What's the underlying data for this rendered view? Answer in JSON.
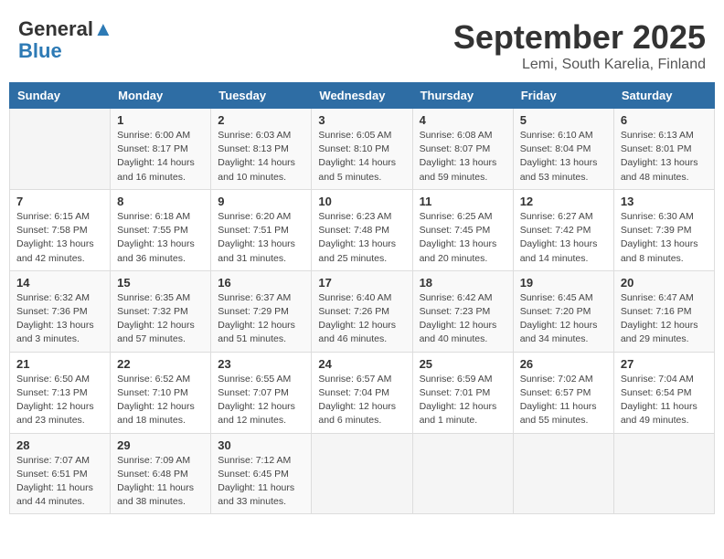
{
  "header": {
    "logo_general": "General",
    "logo_blue": "Blue",
    "month_title": "September 2025",
    "location": "Lemi, South Karelia, Finland"
  },
  "days_of_week": [
    "Sunday",
    "Monday",
    "Tuesday",
    "Wednesday",
    "Thursday",
    "Friday",
    "Saturday"
  ],
  "weeks": [
    [
      {
        "day": "",
        "info": ""
      },
      {
        "day": "1",
        "info": "Sunrise: 6:00 AM\nSunset: 8:17 PM\nDaylight: 14 hours\nand 16 minutes."
      },
      {
        "day": "2",
        "info": "Sunrise: 6:03 AM\nSunset: 8:13 PM\nDaylight: 14 hours\nand 10 minutes."
      },
      {
        "day": "3",
        "info": "Sunrise: 6:05 AM\nSunset: 8:10 PM\nDaylight: 14 hours\nand 5 minutes."
      },
      {
        "day": "4",
        "info": "Sunrise: 6:08 AM\nSunset: 8:07 PM\nDaylight: 13 hours\nand 59 minutes."
      },
      {
        "day": "5",
        "info": "Sunrise: 6:10 AM\nSunset: 8:04 PM\nDaylight: 13 hours\nand 53 minutes."
      },
      {
        "day": "6",
        "info": "Sunrise: 6:13 AM\nSunset: 8:01 PM\nDaylight: 13 hours\nand 48 minutes."
      }
    ],
    [
      {
        "day": "7",
        "info": "Sunrise: 6:15 AM\nSunset: 7:58 PM\nDaylight: 13 hours\nand 42 minutes."
      },
      {
        "day": "8",
        "info": "Sunrise: 6:18 AM\nSunset: 7:55 PM\nDaylight: 13 hours\nand 36 minutes."
      },
      {
        "day": "9",
        "info": "Sunrise: 6:20 AM\nSunset: 7:51 PM\nDaylight: 13 hours\nand 31 minutes."
      },
      {
        "day": "10",
        "info": "Sunrise: 6:23 AM\nSunset: 7:48 PM\nDaylight: 13 hours\nand 25 minutes."
      },
      {
        "day": "11",
        "info": "Sunrise: 6:25 AM\nSunset: 7:45 PM\nDaylight: 13 hours\nand 20 minutes."
      },
      {
        "day": "12",
        "info": "Sunrise: 6:27 AM\nSunset: 7:42 PM\nDaylight: 13 hours\nand 14 minutes."
      },
      {
        "day": "13",
        "info": "Sunrise: 6:30 AM\nSunset: 7:39 PM\nDaylight: 13 hours\nand 8 minutes."
      }
    ],
    [
      {
        "day": "14",
        "info": "Sunrise: 6:32 AM\nSunset: 7:36 PM\nDaylight: 13 hours\nand 3 minutes."
      },
      {
        "day": "15",
        "info": "Sunrise: 6:35 AM\nSunset: 7:32 PM\nDaylight: 12 hours\nand 57 minutes."
      },
      {
        "day": "16",
        "info": "Sunrise: 6:37 AM\nSunset: 7:29 PM\nDaylight: 12 hours\nand 51 minutes."
      },
      {
        "day": "17",
        "info": "Sunrise: 6:40 AM\nSunset: 7:26 PM\nDaylight: 12 hours\nand 46 minutes."
      },
      {
        "day": "18",
        "info": "Sunrise: 6:42 AM\nSunset: 7:23 PM\nDaylight: 12 hours\nand 40 minutes."
      },
      {
        "day": "19",
        "info": "Sunrise: 6:45 AM\nSunset: 7:20 PM\nDaylight: 12 hours\nand 34 minutes."
      },
      {
        "day": "20",
        "info": "Sunrise: 6:47 AM\nSunset: 7:16 PM\nDaylight: 12 hours\nand 29 minutes."
      }
    ],
    [
      {
        "day": "21",
        "info": "Sunrise: 6:50 AM\nSunset: 7:13 PM\nDaylight: 12 hours\nand 23 minutes."
      },
      {
        "day": "22",
        "info": "Sunrise: 6:52 AM\nSunset: 7:10 PM\nDaylight: 12 hours\nand 18 minutes."
      },
      {
        "day": "23",
        "info": "Sunrise: 6:55 AM\nSunset: 7:07 PM\nDaylight: 12 hours\nand 12 minutes."
      },
      {
        "day": "24",
        "info": "Sunrise: 6:57 AM\nSunset: 7:04 PM\nDaylight: 12 hours\nand 6 minutes."
      },
      {
        "day": "25",
        "info": "Sunrise: 6:59 AM\nSunset: 7:01 PM\nDaylight: 12 hours\nand 1 minute."
      },
      {
        "day": "26",
        "info": "Sunrise: 7:02 AM\nSunset: 6:57 PM\nDaylight: 11 hours\nand 55 minutes."
      },
      {
        "day": "27",
        "info": "Sunrise: 7:04 AM\nSunset: 6:54 PM\nDaylight: 11 hours\nand 49 minutes."
      }
    ],
    [
      {
        "day": "28",
        "info": "Sunrise: 7:07 AM\nSunset: 6:51 PM\nDaylight: 11 hours\nand 44 minutes."
      },
      {
        "day": "29",
        "info": "Sunrise: 7:09 AM\nSunset: 6:48 PM\nDaylight: 11 hours\nand 38 minutes."
      },
      {
        "day": "30",
        "info": "Sunrise: 7:12 AM\nSunset: 6:45 PM\nDaylight: 11 hours\nand 33 minutes."
      },
      {
        "day": "",
        "info": ""
      },
      {
        "day": "",
        "info": ""
      },
      {
        "day": "",
        "info": ""
      },
      {
        "day": "",
        "info": ""
      }
    ]
  ]
}
